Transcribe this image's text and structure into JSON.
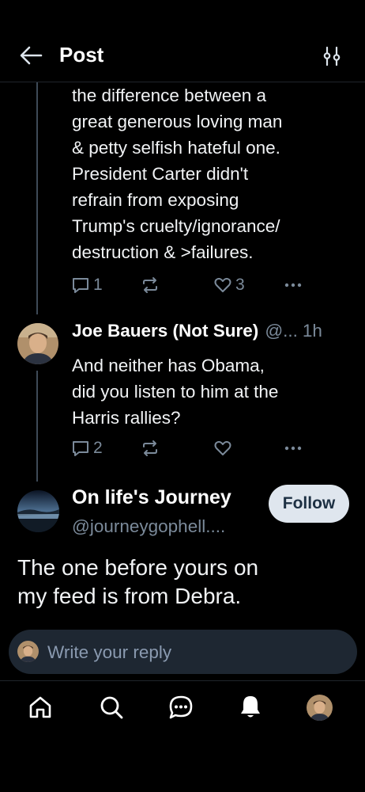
{
  "header": {
    "title": "Post"
  },
  "parent_post": {
    "text": "the difference between a\ngreat generous loving man\n& petty selfish hateful one.\nPresident Carter didn't\nrefrain from exposing\nTrump's cruelty/ignorance/\ndestruction & >failures.",
    "reply_count": "1",
    "like_count": "3"
  },
  "reply_post": {
    "author_name": "Joe Bauers (Not Sure)",
    "handle": "@...",
    "time": "1h",
    "text": "And neither has Obama,\ndid you listen to him at the\nHarris rallies?",
    "reply_count": "2"
  },
  "main_post": {
    "author_name": "On life's Journey",
    "handle": "@journeygophell....",
    "follow_label": "Follow",
    "text": " The one before yours on\nmy feed is from Debra."
  },
  "reply_composer": {
    "placeholder": "Write your reply"
  },
  "tabbar": {
    "items": [
      "home-icon",
      "search-icon",
      "chat-icon",
      "notifications-icon",
      "profile-avatar"
    ]
  },
  "colors": {
    "background": "#000000",
    "muted": "#7b8a9a",
    "follow_bg": "#dfe6ee",
    "composer_bg": "#1e2732"
  }
}
